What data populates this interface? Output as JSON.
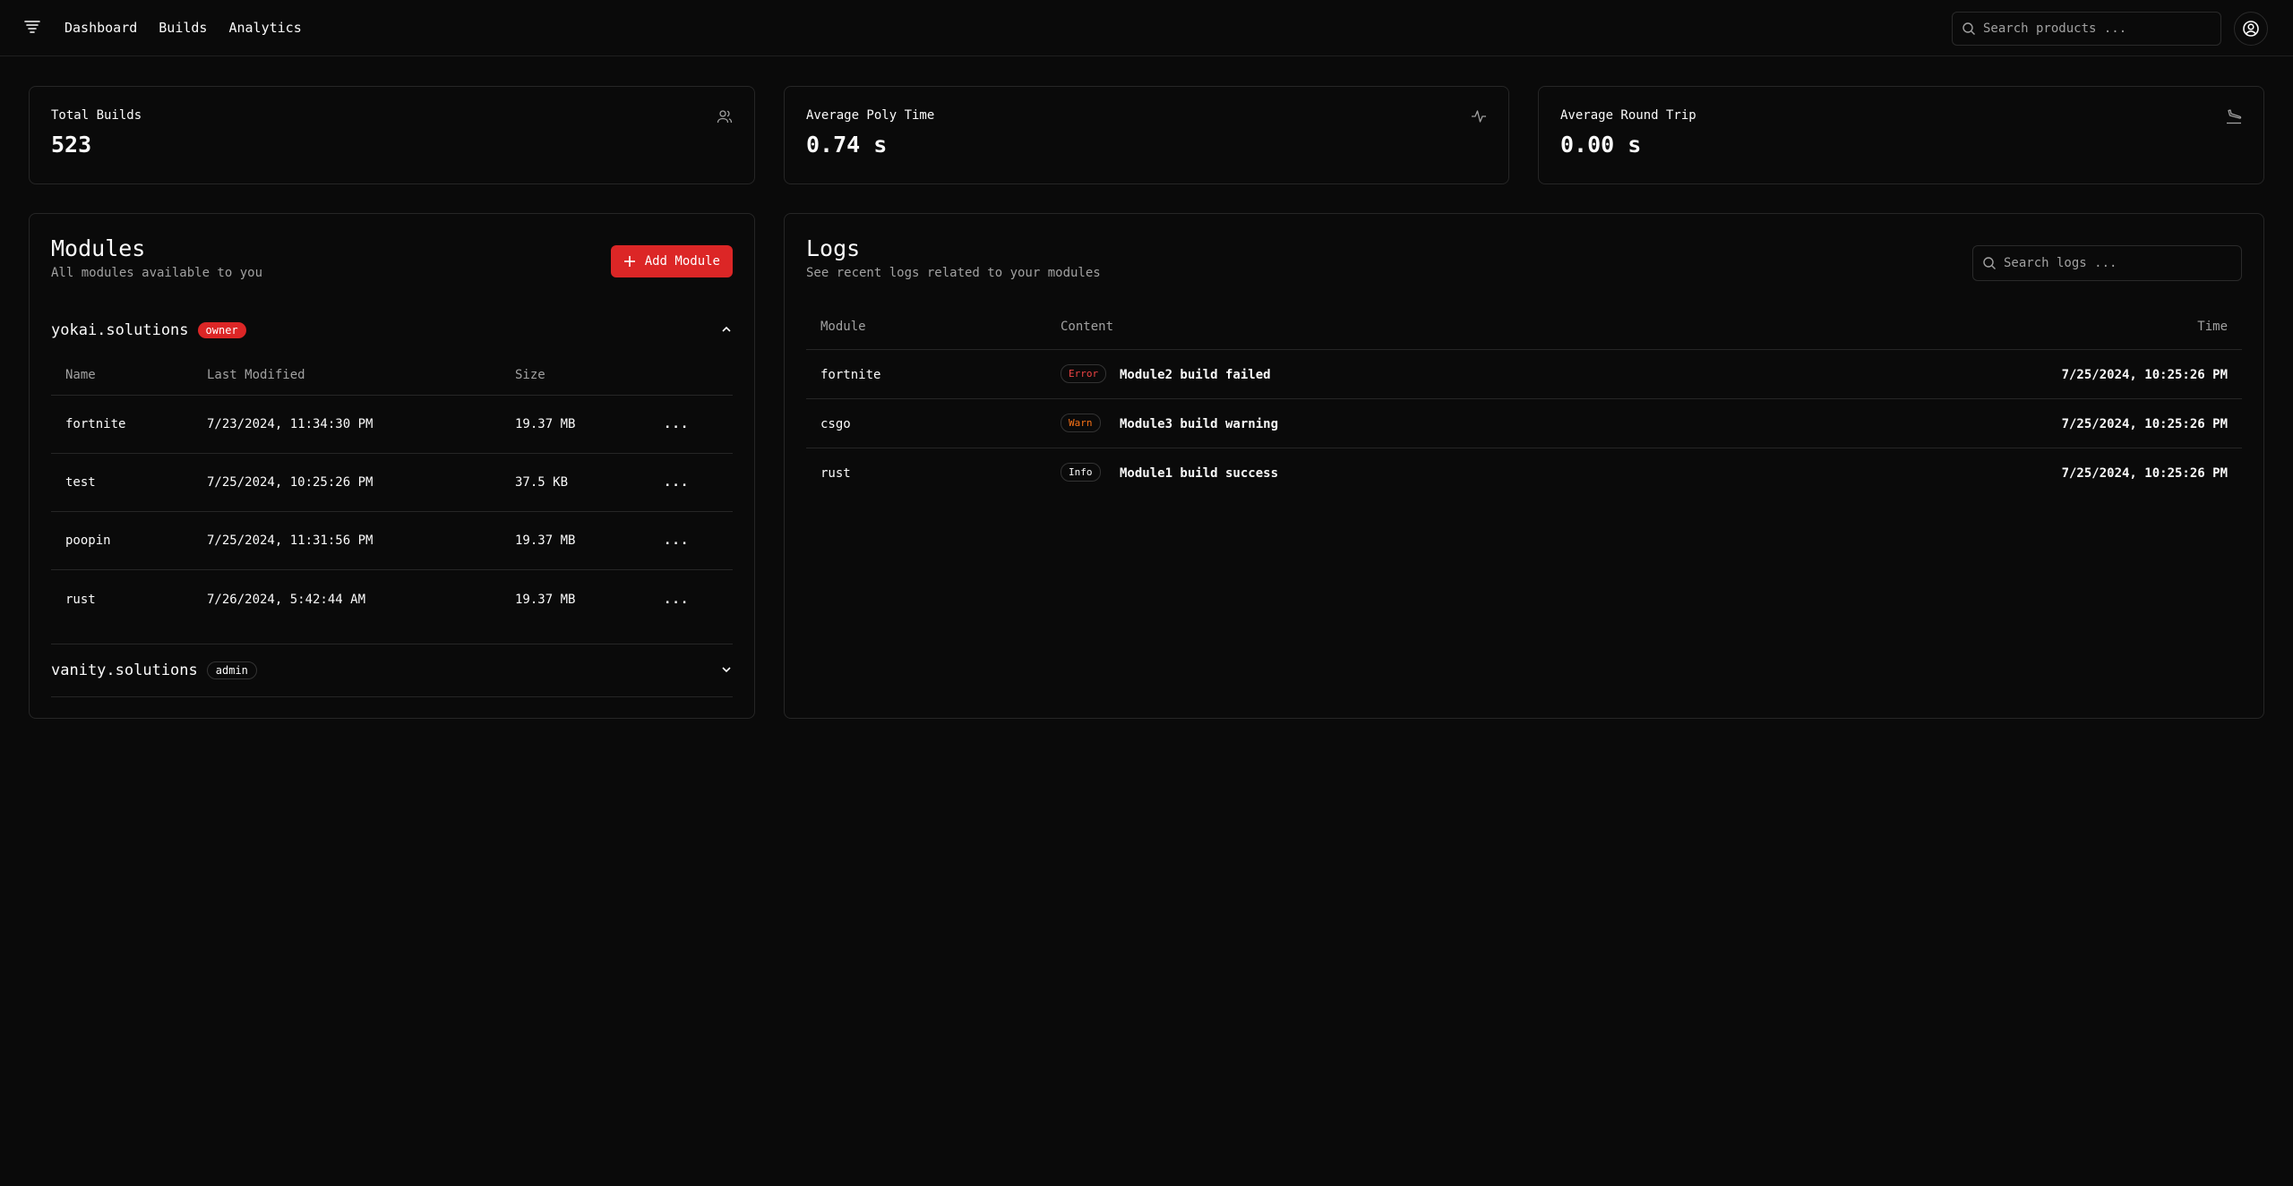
{
  "nav": {
    "links": [
      "Dashboard",
      "Builds",
      "Analytics"
    ],
    "search_placeholder": "Search products ..."
  },
  "stats": [
    {
      "title": "Total Builds",
      "value": "523",
      "icon": "users-icon"
    },
    {
      "title": "Average Poly Time",
      "value": "0.74 s",
      "icon": "activity-icon"
    },
    {
      "title": "Average Round Trip",
      "value": "0.00 s",
      "icon": "plane-landing-icon"
    }
  ],
  "modules": {
    "title": "Modules",
    "subtitle": "All modules available to you",
    "add_label": "Add Module",
    "columns": [
      "Name",
      "Last Modified",
      "Size"
    ],
    "groups": [
      {
        "name": "yokai.solutions",
        "role": "owner",
        "expanded": true,
        "rows": [
          {
            "name": "fortnite",
            "modified": "7/23/2024, 11:34:30 PM",
            "size": "19.37 MB"
          },
          {
            "name": "test",
            "modified": "7/25/2024, 10:25:26 PM",
            "size": "37.5 KB"
          },
          {
            "name": "poopin",
            "modified": "7/25/2024, 11:31:56 PM",
            "size": "19.37 MB"
          },
          {
            "name": "rust",
            "modified": "7/26/2024, 5:42:44 AM",
            "size": "19.37 MB"
          }
        ]
      },
      {
        "name": "vanity.solutions",
        "role": "admin",
        "expanded": false
      }
    ],
    "row_menu": "..."
  },
  "logs": {
    "title": "Logs",
    "subtitle": "See recent logs related to your modules",
    "search_placeholder": "Search logs ...",
    "columns": [
      "Module",
      "Content",
      "Time"
    ],
    "rows": [
      {
        "module": "fortnite",
        "level": "Error",
        "message": "Module2 build failed",
        "time": "7/25/2024, 10:25:26 PM"
      },
      {
        "module": "csgo",
        "level": "Warn",
        "message": "Module3 build warning",
        "time": "7/25/2024, 10:25:26 PM"
      },
      {
        "module": "rust",
        "level": "Info",
        "message": "Module1 build success",
        "time": "7/25/2024, 10:25:26 PM"
      }
    ]
  },
  "colors": {
    "background": "#0a0a0a",
    "accent": "#dc2626",
    "error": "#ef4444",
    "warn": "#f97316",
    "muted": "#a1a1a1"
  }
}
